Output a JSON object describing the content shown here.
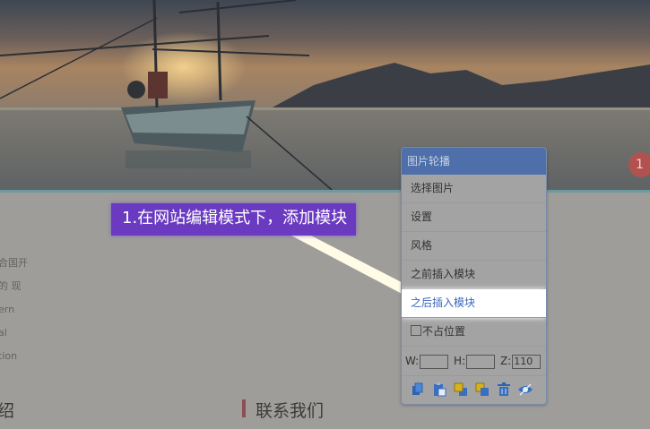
{
  "banner": {
    "badge": "1"
  },
  "left_column": {
    "lines": [
      "合国开",
      "的 现",
      "ern",
      "al",
      "tion"
    ],
    "heading": "绍"
  },
  "contact": {
    "heading": "联系我们"
  },
  "callout": {
    "text": "1.在网站编辑模式下，添加模块"
  },
  "menu": {
    "title": "图片轮播",
    "items": [
      {
        "label": "选择图片"
      },
      {
        "label": "设置"
      },
      {
        "label": "风格"
      },
      {
        "label": "之前插入模块"
      },
      {
        "label": "之后插入模块"
      }
    ],
    "checkbox_label": "不占位置",
    "size": {
      "w_label": "W:",
      "w_value": "",
      "h_label": "H:",
      "h_value": "",
      "z_label": "Z:",
      "z_value": "110"
    },
    "toolbar_icons": [
      "copy-icon",
      "paste-icon",
      "bring-forward-icon",
      "send-backward-icon",
      "trash-icon",
      "eye-icon"
    ]
  },
  "colors": {
    "menu_header": "#4e6faa",
    "callout": "#6a3bc0",
    "active_item_text": "#3a67b7"
  }
}
